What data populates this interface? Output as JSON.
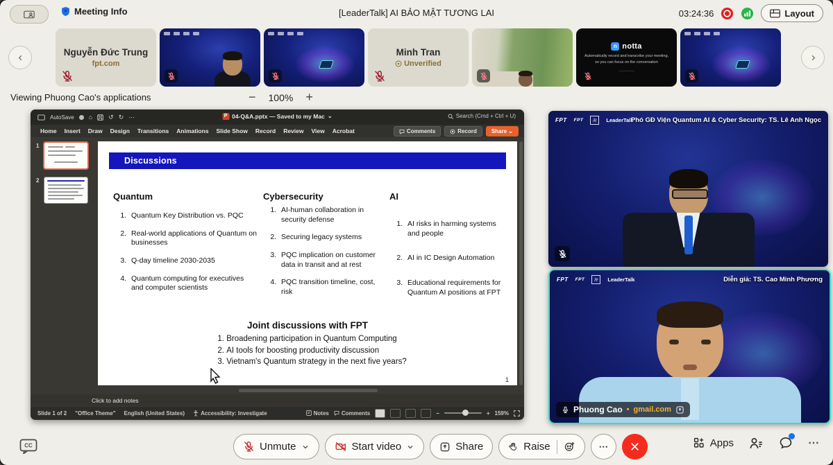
{
  "topbar": {
    "meeting_info": "Meeting Info",
    "title": "[LeaderTalk] AI BẢO MẬT TƯƠNG LAI",
    "timer": "03:24:36",
    "layout": "Layout"
  },
  "strip": {
    "tile1_name": "Nguyễn Đức Trung",
    "tile1_sub": "fpt.com",
    "tile4_name": "Minh Tran",
    "tile4_sub": "Unverified",
    "notta_brand": "notta",
    "notta_icon_letter": "n",
    "notta_line1": "Automatically record and transcribe your meeting,",
    "notta_line2": "so you can focus on the conversation"
  },
  "banner": {
    "text": "Viewing Phuong Cao's applications",
    "minus": "−",
    "zoom": "100%",
    "plus": "+"
  },
  "ppt": {
    "autosave": "AutoSave",
    "home_glyph": "⌂",
    "undo_glyph": "↺",
    "redo_glyph": "↻",
    "more_glyph": "⋯",
    "icon_letter": "P",
    "filename": "04-Q&A.pptx — Saved to my Mac",
    "chevron": "⌄",
    "search": "Search (Cmd + Ctrl + U)",
    "tabs": [
      "Home",
      "Insert",
      "Draw",
      "Design",
      "Transitions",
      "Animations",
      "Slide Show",
      "Record",
      "Review",
      "View",
      "Acrobat"
    ],
    "btn_comments": "Comments",
    "btn_record": "Record",
    "btn_share": "Share ⌄",
    "thumb1": "1",
    "thumb2": "2",
    "slide": {
      "title": "Discussions",
      "columns": [
        {
          "heading": "Quantum",
          "items": [
            "Quantum Key Distribution vs. PQC",
            "Real-world applications of Quantum on businesses",
            "Q-day timeline 2030-2035",
            "Quantum computing for executives and computer scientists"
          ]
        },
        {
          "heading": "Cybersecurity",
          "items": [
            "AI-human collaboration in security defense",
            "Securing legacy systems",
            "PQC implication on customer data in transit and at rest",
            "PQC transition timeline, cost, risk"
          ]
        },
        {
          "heading": "AI",
          "items": [
            "AI risks in harming systems and people",
            "AI in IC Design Automation",
            "Educational requirements for Quantum AI positions at FPT"
          ]
        }
      ],
      "joint_heading": "Joint discussions with FPT",
      "joint_items": [
        "Broadening participation in Quantum Computing",
        "AI tools for boosting productivity discussion",
        "Vietnam's Quantum strategy in the next five years?"
      ],
      "page": "1"
    },
    "notes_placeholder": "Click to add notes",
    "status": {
      "slide": "Slide 1 of 2",
      "theme": "\"Office Theme\"",
      "lang": "English (United States)",
      "accessibility": "Accessibility: Investigate",
      "notes": "Notes",
      "comments": "Comments",
      "minus": "−",
      "plus": "+",
      "zoom": "159%"
    }
  },
  "videos": {
    "fpt": "FPT",
    "hv": "FPT",
    "leadertalk": "LeaderTalk",
    "v1_caption": "Phó GĐ Viện Quantum AI & Cyber Security: TS. Lê Anh Ngọc",
    "v2_caption": "Diễn giả: TS. Cao Minh Phương",
    "v2_name": "Phuong Cao",
    "v2_bullet": "•",
    "v2_domain": "gmail.com"
  },
  "controls": {
    "unmute": "Unmute",
    "start_video": "Start video",
    "share": "Share",
    "raise": "Raise",
    "more": "⋯",
    "apps": "Apps"
  },
  "colors": {
    "accent_red": "#cf2c2c",
    "leave_red": "#f52b1e",
    "share_orange": "#e8612c",
    "banner_blue": "#1517bd",
    "active_speaker_border": "#38dcc6",
    "record_red": "#e02020",
    "online_green": "#28b446",
    "unverified_gold": "#8a6d34"
  }
}
